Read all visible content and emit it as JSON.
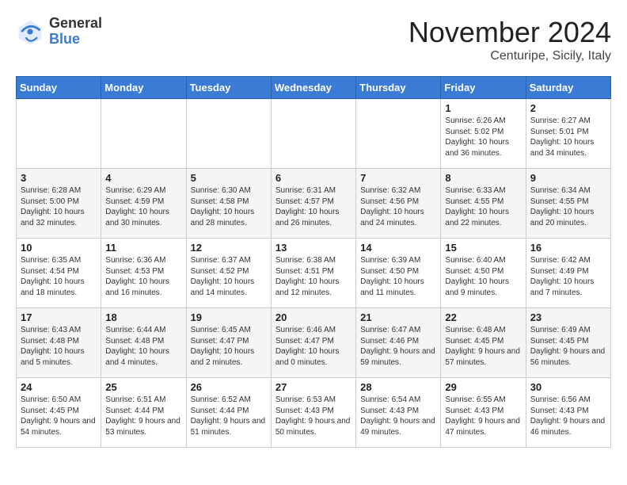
{
  "header": {
    "logo_general": "General",
    "logo_blue": "Blue",
    "title": "November 2024",
    "location": "Centuripe, Sicily, Italy"
  },
  "days_of_week": [
    "Sunday",
    "Monday",
    "Tuesday",
    "Wednesday",
    "Thursday",
    "Friday",
    "Saturday"
  ],
  "weeks": [
    [
      {
        "day": "",
        "info": ""
      },
      {
        "day": "",
        "info": ""
      },
      {
        "day": "",
        "info": ""
      },
      {
        "day": "",
        "info": ""
      },
      {
        "day": "",
        "info": ""
      },
      {
        "day": "1",
        "info": "Sunrise: 6:26 AM\nSunset: 5:02 PM\nDaylight: 10 hours\nand 36 minutes."
      },
      {
        "day": "2",
        "info": "Sunrise: 6:27 AM\nSunset: 5:01 PM\nDaylight: 10 hours\nand 34 minutes."
      }
    ],
    [
      {
        "day": "3",
        "info": "Sunrise: 6:28 AM\nSunset: 5:00 PM\nDaylight: 10 hours\nand 32 minutes."
      },
      {
        "day": "4",
        "info": "Sunrise: 6:29 AM\nSunset: 4:59 PM\nDaylight: 10 hours\nand 30 minutes."
      },
      {
        "day": "5",
        "info": "Sunrise: 6:30 AM\nSunset: 4:58 PM\nDaylight: 10 hours\nand 28 minutes."
      },
      {
        "day": "6",
        "info": "Sunrise: 6:31 AM\nSunset: 4:57 PM\nDaylight: 10 hours\nand 26 minutes."
      },
      {
        "day": "7",
        "info": "Sunrise: 6:32 AM\nSunset: 4:56 PM\nDaylight: 10 hours\nand 24 minutes."
      },
      {
        "day": "8",
        "info": "Sunrise: 6:33 AM\nSunset: 4:55 PM\nDaylight: 10 hours\nand 22 minutes."
      },
      {
        "day": "9",
        "info": "Sunrise: 6:34 AM\nSunset: 4:55 PM\nDaylight: 10 hours\nand 20 minutes."
      }
    ],
    [
      {
        "day": "10",
        "info": "Sunrise: 6:35 AM\nSunset: 4:54 PM\nDaylight: 10 hours\nand 18 minutes."
      },
      {
        "day": "11",
        "info": "Sunrise: 6:36 AM\nSunset: 4:53 PM\nDaylight: 10 hours\nand 16 minutes."
      },
      {
        "day": "12",
        "info": "Sunrise: 6:37 AM\nSunset: 4:52 PM\nDaylight: 10 hours\nand 14 minutes."
      },
      {
        "day": "13",
        "info": "Sunrise: 6:38 AM\nSunset: 4:51 PM\nDaylight: 10 hours\nand 12 minutes."
      },
      {
        "day": "14",
        "info": "Sunrise: 6:39 AM\nSunset: 4:50 PM\nDaylight: 10 hours\nand 11 minutes."
      },
      {
        "day": "15",
        "info": "Sunrise: 6:40 AM\nSunset: 4:50 PM\nDaylight: 10 hours\nand 9 minutes."
      },
      {
        "day": "16",
        "info": "Sunrise: 6:42 AM\nSunset: 4:49 PM\nDaylight: 10 hours\nand 7 minutes."
      }
    ],
    [
      {
        "day": "17",
        "info": "Sunrise: 6:43 AM\nSunset: 4:48 PM\nDaylight: 10 hours\nand 5 minutes."
      },
      {
        "day": "18",
        "info": "Sunrise: 6:44 AM\nSunset: 4:48 PM\nDaylight: 10 hours\nand 4 minutes."
      },
      {
        "day": "19",
        "info": "Sunrise: 6:45 AM\nSunset: 4:47 PM\nDaylight: 10 hours\nand 2 minutes."
      },
      {
        "day": "20",
        "info": "Sunrise: 6:46 AM\nSunset: 4:47 PM\nDaylight: 10 hours\nand 0 minutes."
      },
      {
        "day": "21",
        "info": "Sunrise: 6:47 AM\nSunset: 4:46 PM\nDaylight: 9 hours\nand 59 minutes."
      },
      {
        "day": "22",
        "info": "Sunrise: 6:48 AM\nSunset: 4:45 PM\nDaylight: 9 hours\nand 57 minutes."
      },
      {
        "day": "23",
        "info": "Sunrise: 6:49 AM\nSunset: 4:45 PM\nDaylight: 9 hours\nand 56 minutes."
      }
    ],
    [
      {
        "day": "24",
        "info": "Sunrise: 6:50 AM\nSunset: 4:45 PM\nDaylight: 9 hours\nand 54 minutes."
      },
      {
        "day": "25",
        "info": "Sunrise: 6:51 AM\nSunset: 4:44 PM\nDaylight: 9 hours\nand 53 minutes."
      },
      {
        "day": "26",
        "info": "Sunrise: 6:52 AM\nSunset: 4:44 PM\nDaylight: 9 hours\nand 51 minutes."
      },
      {
        "day": "27",
        "info": "Sunrise: 6:53 AM\nSunset: 4:43 PM\nDaylight: 9 hours\nand 50 minutes."
      },
      {
        "day": "28",
        "info": "Sunrise: 6:54 AM\nSunset: 4:43 PM\nDaylight: 9 hours\nand 49 minutes."
      },
      {
        "day": "29",
        "info": "Sunrise: 6:55 AM\nSunset: 4:43 PM\nDaylight: 9 hours\nand 47 minutes."
      },
      {
        "day": "30",
        "info": "Sunrise: 6:56 AM\nSunset: 4:43 PM\nDaylight: 9 hours\nand 46 minutes."
      }
    ]
  ]
}
